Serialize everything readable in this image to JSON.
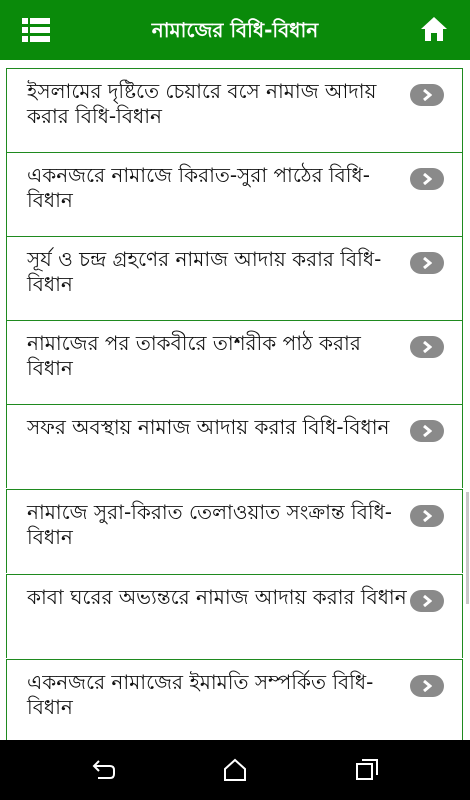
{
  "app_bar": {
    "title": "নামাজের বিধি-বিধান",
    "color": "#0a8a0a",
    "menu_icon": "list-menu-icon",
    "home_icon": "home-icon"
  },
  "list": {
    "items": [
      {
        "label": "ইসলামের দৃষ্টিতে চেয়ারে বসে নামাজ আদায় করার বিধি-বিধান"
      },
      {
        "label": "একনজরে নামাজে কিরাত-সুরা পাঠের বিধি-বিধান"
      },
      {
        "label": "সূর্য ও চন্দ্র গ্রহণের নামাজ আদায় করার বিধি-বিধান"
      },
      {
        "label": "নামাজের পর তাকবীরে তাশরীক পাঠ করার বিধান"
      },
      {
        "label": "সফর অবস্থায় নামাজ আদায় করার বিধি-বিধান"
      },
      {
        "label": "নামাজে সুরা-কিরাত তেলাওয়াত সংক্রান্ত বিধি-বিধান"
      },
      {
        "label": "কাবা ঘরের অভ্যন্তরে নামাজ আদায় করার বিধান"
      },
      {
        "label": "একনজরে নামাজের ইমামতি সম্পর্কিত বিধি-বিধান"
      }
    ],
    "chevron_icon": "chevron-right-icon",
    "border_color": "#1f8a1f"
  },
  "nav_bar": {
    "back_icon": "back-icon",
    "home_icon": "home-outline-icon",
    "recents_icon": "recents-icon"
  }
}
